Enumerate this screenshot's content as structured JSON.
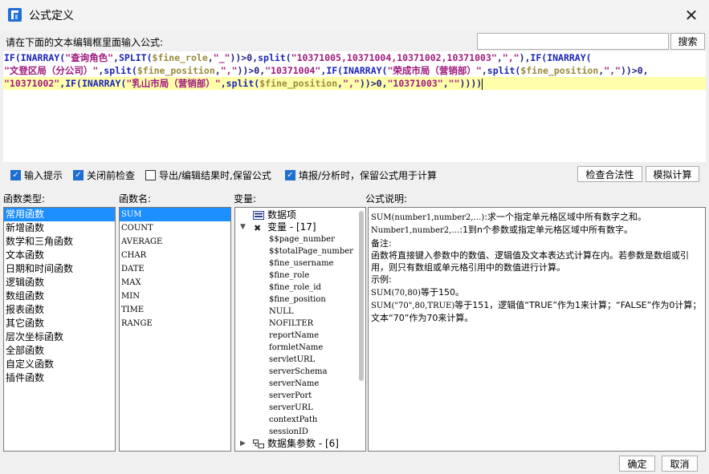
{
  "window": {
    "title": "公式定义"
  },
  "prompt": "请在下面的文本编辑框里面输入公式:",
  "search": {
    "value": "",
    "button": "搜索"
  },
  "formula": {
    "lines": [
      [
        {
          "t": "kw",
          "v": "IF(INARRAY("
        },
        {
          "t": "st",
          "v": "\"查询角色\""
        },
        {
          "t": "pn",
          "v": ","
        },
        {
          "t": "kw",
          "v": "SPLIT("
        },
        {
          "t": "vr",
          "v": "$fine_role"
        },
        {
          "t": "pn",
          "v": ","
        },
        {
          "t": "st",
          "v": "\"_\""
        },
        {
          "t": "pn",
          "v": "))>0,"
        },
        {
          "t": "kw",
          "v": "split("
        },
        {
          "t": "st",
          "v": "\"10371005,10371004,10371002,10371003\""
        },
        {
          "t": "pn",
          "v": ","
        },
        {
          "t": "st",
          "v": "\",\""
        },
        {
          "t": "pn",
          "v": "),"
        },
        {
          "t": "kw",
          "v": "IF(INARRAY("
        }
      ],
      [
        {
          "t": "st",
          "v": "\"文登区局（分公司）\""
        },
        {
          "t": "pn",
          "v": ","
        },
        {
          "t": "kw",
          "v": "split("
        },
        {
          "t": "vr",
          "v": "$fine_position"
        },
        {
          "t": "pn",
          "v": ","
        },
        {
          "t": "st",
          "v": "\",\""
        },
        {
          "t": "pn",
          "v": "))>0,"
        },
        {
          "t": "st",
          "v": "\"10371004\""
        },
        {
          "t": "pn",
          "v": ","
        },
        {
          "t": "kw",
          "v": "IF(INARRAY("
        },
        {
          "t": "st",
          "v": "\"荣成市局（营销部）\""
        },
        {
          "t": "pn",
          "v": ","
        },
        {
          "t": "kw",
          "v": "split("
        },
        {
          "t": "vr",
          "v": "$fine_position"
        },
        {
          "t": "pn",
          "v": ","
        },
        {
          "t": "st",
          "v": "\",\""
        },
        {
          "t": "pn",
          "v": "))>0,"
        }
      ],
      [
        {
          "t": "st",
          "v": "\"10371002\""
        },
        {
          "t": "pn",
          "v": ","
        },
        {
          "t": "kw",
          "v": "IF(INARRAY("
        },
        {
          "t": "st",
          "v": "\"乳山市局（营销部）\""
        },
        {
          "t": "pn",
          "v": ","
        },
        {
          "t": "kw",
          "v": "split("
        },
        {
          "t": "vr",
          "v": "$fine_position"
        },
        {
          "t": "pn",
          "v": ","
        },
        {
          "t": "st",
          "v": "\",\""
        },
        {
          "t": "pn",
          "v": "))>0,"
        },
        {
          "t": "st",
          "v": "\"10371003\""
        },
        {
          "t": "pn",
          "v": ","
        },
        {
          "t": "st",
          "v": "\"\""
        },
        {
          "t": "pn",
          "v": "))))"
        }
      ]
    ]
  },
  "options": [
    {
      "label": "输入提示",
      "checked": true
    },
    {
      "label": "关闭前检查",
      "checked": true
    },
    {
      "label": "导出/编辑结果时,保留公式",
      "checked": false
    },
    {
      "label": "填报/分析时，保留公式用于计算",
      "checked": true
    }
  ],
  "buttons": {
    "check": "检查合法性",
    "simulate": "模拟计算",
    "ok": "确定",
    "cancel": "取消"
  },
  "labels": {
    "func_type": "函数类型:",
    "func_name": "函数名:",
    "variables": "变量:",
    "description": "公式说明:"
  },
  "func_types": [
    "常用函数",
    "新增函数",
    "数学和三角函数",
    "文本函数",
    "日期和时间函数",
    "逻辑函数",
    "数组函数",
    "报表函数",
    "其它函数",
    "层次坐标函数",
    "全部函数",
    "自定义函数",
    "插件函数"
  ],
  "func_names": [
    "SUM",
    "COUNT",
    "AVERAGE",
    "CHAR",
    "DATE",
    "MAX",
    "MIN",
    "TIME",
    "RANGE"
  ],
  "variables": {
    "data_item": "数据项",
    "var_group": "变量 - [17]",
    "vars": [
      "$$page_number",
      "$$totalPage_number",
      "$fine_username",
      "$fine_role",
      "$fine_role_id",
      "$fine_position",
      "NULL",
      "NOFILTER",
      "reportName",
      "formletName",
      "servletURL",
      "serverSchema",
      "serverName",
      "serverPort",
      "serverURL",
      "contextPath",
      "sessionID"
    ],
    "dataset_params": "数据集参数 - [6]"
  },
  "description": {
    "signature": "SUM(number1,number2,…)",
    "signature_text": ":求一个指定单元格区域中所有数字之和。",
    "args": "Number1,number2,…",
    "args_text": ":1到n个参数或指定单元格区域中所有数字。",
    "remark_label": "备注:",
    "remark": "函数将直接键入参数中的数值、逻辑值及文本表达式计算在内。若参数是数组或引用，则只有数组或单元格引用中的数值进行计算。",
    "example_label": "示例:",
    "example1_code": "SUM(70,80)",
    "example1_text": "等于150。",
    "example2_code": "SUM(\"70\",80,TRUE)",
    "example2_text": "等于151，逻辑值“TRUE”作为1来计算；“FALSE”作为0计算；文本“70”作为70来计算。"
  }
}
